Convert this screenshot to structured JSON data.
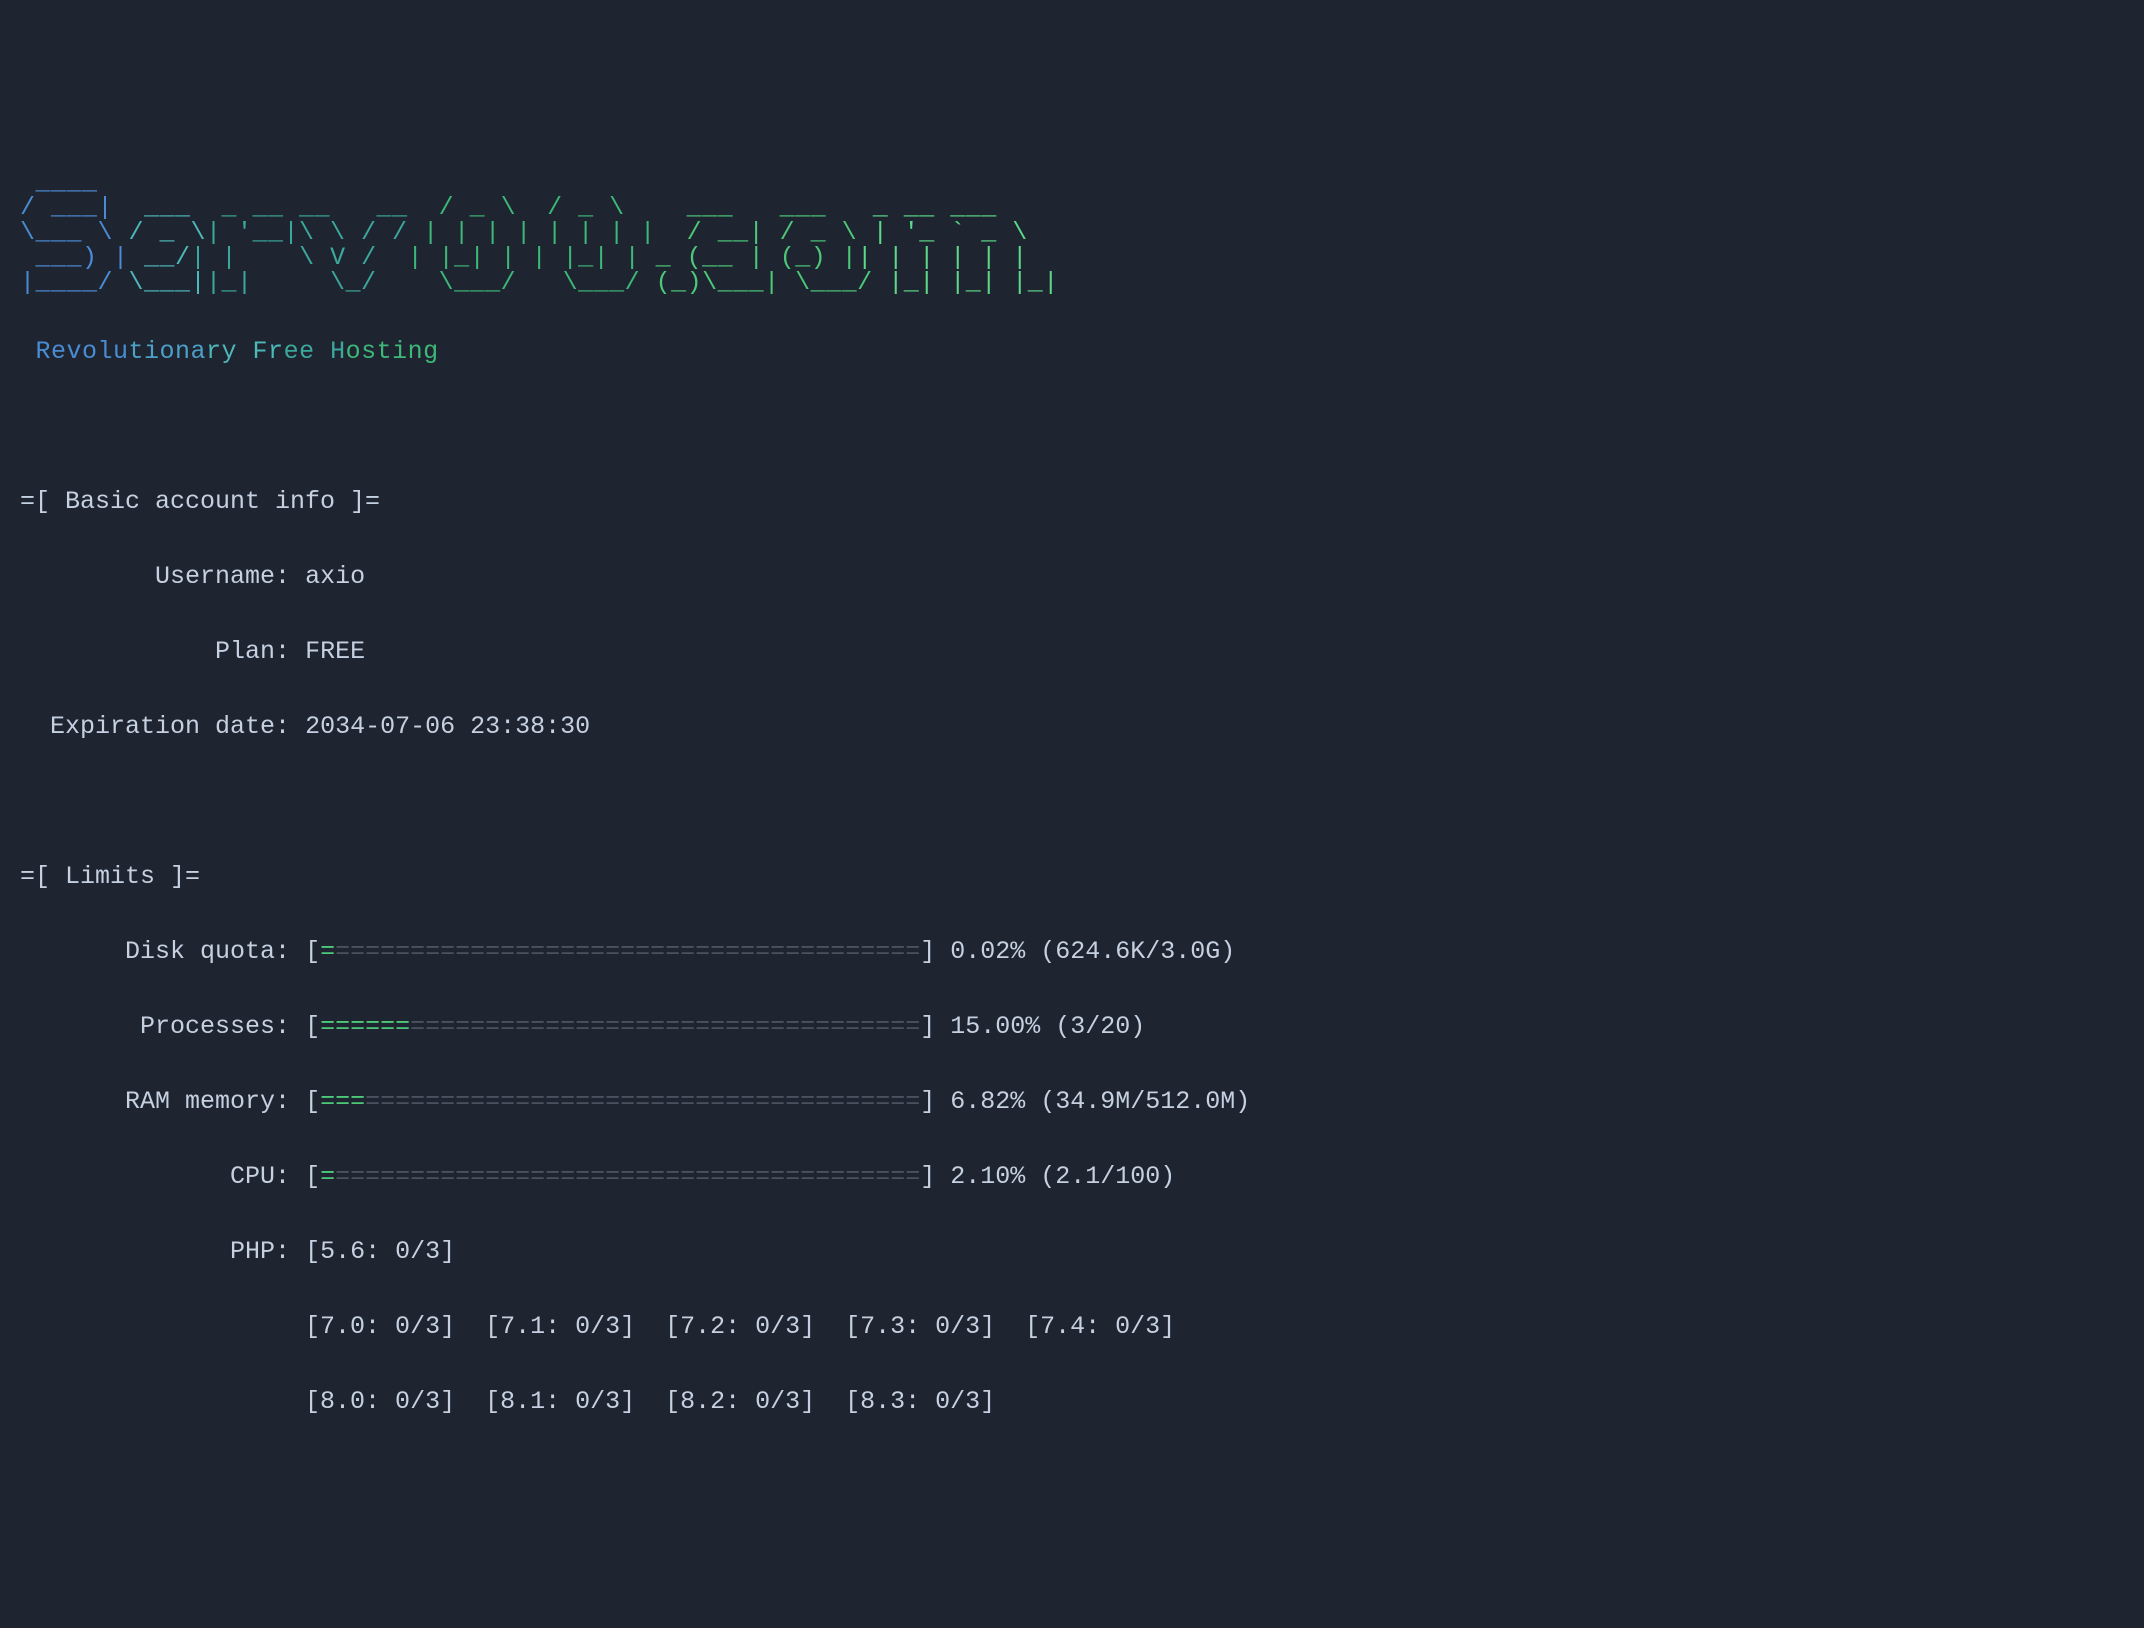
{
  "logo": {
    "tagline_parts": [
      "Revolu",
      "tiona",
      "ry Fr",
      "ee H",
      "osting"
    ]
  },
  "sections": {
    "basic_info": {
      "header": "=[ Basic account info ]=",
      "username_label": "Username:",
      "username_value": "axio",
      "plan_label": "Plan:",
      "plan_value": "FREE",
      "expiration_label": "Expiration date:",
      "expiration_value": "2034-07-06 23:38:30"
    },
    "limits": {
      "header": "=[ Limits ]=",
      "disk": {
        "label": "Disk quota:",
        "bar_fill": "=",
        "bar_empty": "=======================================",
        "percent": "0.02%",
        "detail": "(624.6K/3.0G)"
      },
      "processes": {
        "label": "Processes:",
        "bar_fill": "======",
        "bar_empty": "==================================",
        "percent": "15.00%",
        "detail": "(3/20)"
      },
      "ram": {
        "label": "RAM memory:",
        "bar_fill": "===",
        "bar_empty": "=====================================",
        "percent": "6.82%",
        "detail": "(34.9M/512.0M)"
      },
      "cpu": {
        "label": "CPU:",
        "bar_fill": "=",
        "bar_empty": "=======================================",
        "percent": "2.10%",
        "detail": "(2.1/100)"
      },
      "php": {
        "label": "PHP:",
        "line1": "[5.6: 0/3]",
        "line2": "[7.0: 0/3]  [7.1: 0/3]  [7.2: 0/3]  [7.3: 0/3]  [7.4: 0/3]",
        "line3": "[8.0: 0/3]  [8.1: 0/3]  [8.2: 0/3]  [8.3: 0/3]"
      }
    }
  }
}
